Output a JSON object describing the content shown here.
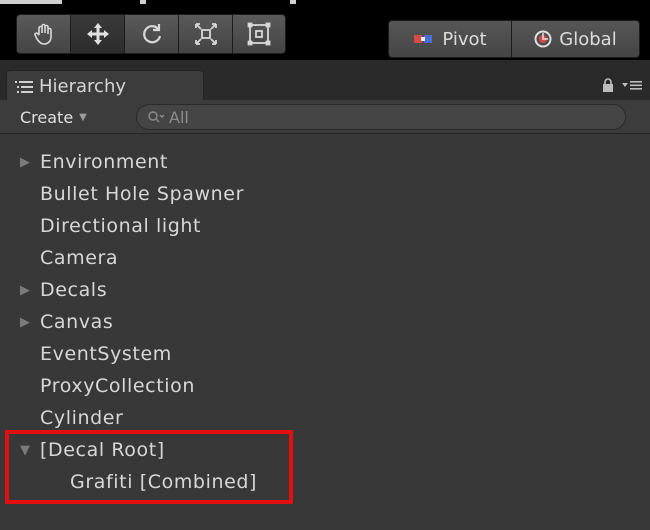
{
  "toolbar": {
    "tools": [
      {
        "name": "hand-tool",
        "icon": "hand-icon"
      },
      {
        "name": "move-tool",
        "icon": "move-icon"
      },
      {
        "name": "rotate-tool",
        "icon": "rotate-icon"
      },
      {
        "name": "scale-tool",
        "icon": "scale-icon"
      },
      {
        "name": "rect-tool",
        "icon": "rect-icon"
      }
    ],
    "pivot_label": "Pivot",
    "global_label": "Global"
  },
  "hierarchy": {
    "tab_label": "Hierarchy",
    "create_label": "Create",
    "search_placeholder": "All",
    "items": [
      {
        "label": "Environment",
        "expandable": true,
        "expanded": false,
        "depth": 0
      },
      {
        "label": "Bullet Hole Spawner",
        "expandable": false,
        "depth": 0
      },
      {
        "label": "Directional light",
        "expandable": false,
        "depth": 0
      },
      {
        "label": "Camera",
        "expandable": false,
        "depth": 0
      },
      {
        "label": "Decals",
        "expandable": true,
        "expanded": false,
        "depth": 0
      },
      {
        "label": "Canvas",
        "expandable": true,
        "expanded": false,
        "depth": 0
      },
      {
        "label": "EventSystem",
        "expandable": false,
        "depth": 0
      },
      {
        "label": "ProxyCollection",
        "expandable": false,
        "depth": 0
      },
      {
        "label": "Cylinder",
        "expandable": false,
        "depth": 0
      },
      {
        "label": "[Decal Root]",
        "expandable": true,
        "expanded": true,
        "depth": 0
      },
      {
        "label": "Grafiti [Combined]",
        "expandable": false,
        "depth": 1
      }
    ]
  },
  "colors": {
    "highlight": "#e01010",
    "panel_bg": "#383838"
  }
}
